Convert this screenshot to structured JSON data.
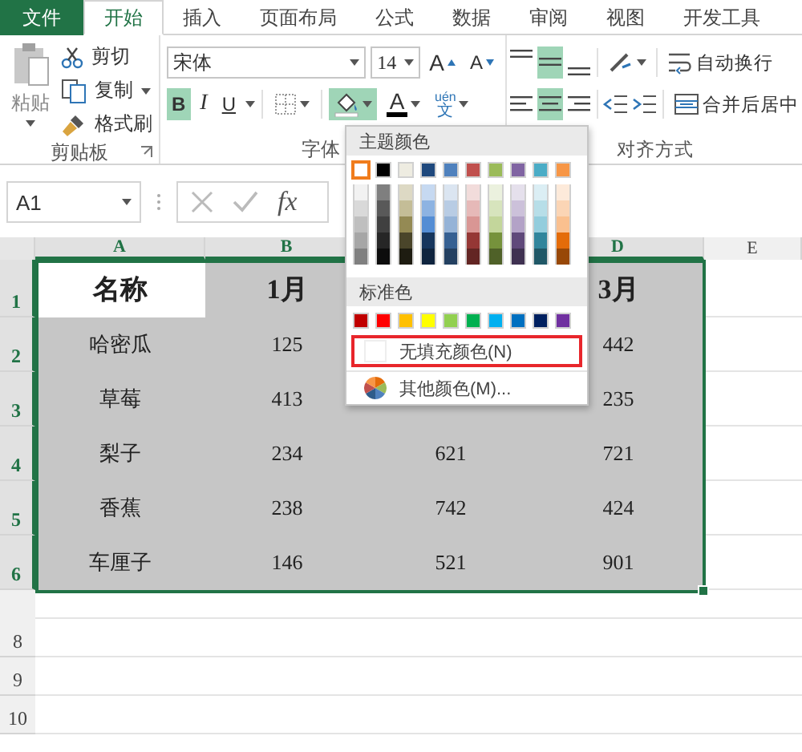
{
  "tabs": [
    {
      "label": "文件",
      "kind": "file",
      "selected": false
    },
    {
      "label": "开始",
      "kind": "tab",
      "selected": true
    },
    {
      "label": "插入",
      "kind": "tab",
      "selected": false
    },
    {
      "label": "页面布局",
      "kind": "tab",
      "selected": false
    },
    {
      "label": "公式",
      "kind": "tab",
      "selected": false
    },
    {
      "label": "数据",
      "kind": "tab",
      "selected": false
    },
    {
      "label": "审阅",
      "kind": "tab",
      "selected": false
    },
    {
      "label": "视图",
      "kind": "tab",
      "selected": false
    },
    {
      "label": "开发工具",
      "kind": "tab",
      "selected": false
    }
  ],
  "ribbon": {
    "clipboard": {
      "paste": "粘贴",
      "cut": "剪切",
      "copy": "复制",
      "format_painter": "格式刷",
      "label": "剪贴板"
    },
    "font": {
      "name": "宋体",
      "size": "14",
      "grow": "A",
      "shrink": "A",
      "bold": {
        "label": "B",
        "on": true
      },
      "italic": {
        "label": "I",
        "on": false
      },
      "underline": {
        "label": "U",
        "on": false
      },
      "fill_color": {
        "on": true
      },
      "font_color": {
        "label": "A"
      },
      "phonetic": {
        "top": "uén",
        "bottom": "文"
      },
      "label": "字体"
    },
    "alignment": {
      "vertical": [
        {
          "kind": "top",
          "selected": false
        },
        {
          "kind": "middle",
          "selected": true
        },
        {
          "kind": "bottom",
          "selected": false
        }
      ],
      "horizontal": [
        {
          "kind": "left",
          "selected": false
        },
        {
          "kind": "center",
          "selected": true
        },
        {
          "kind": "right",
          "selected": false
        }
      ],
      "wrap": "自动换行",
      "merge": "合并后居中",
      "label": "对齐方式"
    }
  },
  "formula_bar": {
    "name_box": "A1",
    "fx": "fx"
  },
  "sheet": {
    "columns": [
      {
        "label": "A",
        "selected": true
      },
      {
        "label": "B",
        "selected": true
      },
      {},
      {
        "label": "D",
        "selected": true
      },
      {
        "label": "E",
        "selected": false
      }
    ],
    "rows": [
      {
        "number": "1",
        "selected": true,
        "cells": [
          {
            "text": "名称",
            "active": true
          },
          {
            "text": "1月",
            "active": false
          },
          {},
          {
            "text": "3月",
            "active": false
          }
        ]
      },
      {
        "number": "2",
        "selected": true,
        "cells": [
          {
            "text": "哈密瓜",
            "active": false
          },
          {
            "text": "125",
            "active": false
          },
          {},
          {
            "text": "442",
            "active": false
          }
        ]
      },
      {
        "number": "3",
        "selected": true,
        "cells": [
          {
            "text": "草莓",
            "active": false
          },
          {
            "text": "413",
            "active": false
          },
          {},
          {
            "text": "235",
            "active": false
          }
        ]
      },
      {
        "number": "4",
        "selected": true,
        "cells": [
          {
            "text": "梨子",
            "active": false
          },
          {
            "text": "234",
            "active": false
          },
          {
            "text": "621",
            "active": false
          },
          {
            "text": "721",
            "active": false
          }
        ]
      },
      {
        "number": "5",
        "selected": true,
        "cells": [
          {
            "text": "香蕉",
            "active": false
          },
          {
            "text": "238",
            "active": false
          },
          {
            "text": "742",
            "active": false
          },
          {
            "text": "424",
            "active": false
          }
        ]
      },
      {
        "number": "6",
        "selected": true,
        "cells": [
          {
            "text": "车厘子",
            "active": false
          },
          {
            "text": "146",
            "active": false
          },
          {
            "text": "521",
            "active": false
          },
          {
            "text": "901",
            "active": false
          }
        ]
      }
    ],
    "extra_rows": [
      {
        "number": "8",
        "selected": false
      },
      {
        "number": "9",
        "selected": false
      },
      {
        "number": "10",
        "selected": false
      }
    ]
  },
  "color_menu": {
    "theme_title": "主题颜色",
    "theme": [
      {
        "color": "#ffffff",
        "selected": true,
        "shades": [
          {
            "color": "#f2f2f2"
          },
          {
            "color": "#d9d9d9"
          },
          {
            "color": "#bfbfbf"
          },
          {
            "color": "#a6a6a6"
          },
          {
            "color": "#808080"
          }
        ]
      },
      {
        "color": "#000000",
        "selected": false,
        "shades": [
          {
            "color": "#7f7f7f"
          },
          {
            "color": "#595959"
          },
          {
            "color": "#404040"
          },
          {
            "color": "#262626"
          },
          {
            "color": "#0d0d0d"
          }
        ]
      },
      {
        "color": "#eeece1",
        "selected": false,
        "shades": [
          {
            "color": "#ddd9c4"
          },
          {
            "color": "#c4bd97"
          },
          {
            "color": "#948a54"
          },
          {
            "color": "#4a452a"
          },
          {
            "color": "#1e1c11"
          }
        ]
      },
      {
        "color": "#1f497d",
        "selected": false,
        "shades": [
          {
            "color": "#c6d9f1"
          },
          {
            "color": "#8db3e2"
          },
          {
            "color": "#548dd4"
          },
          {
            "color": "#17365d"
          },
          {
            "color": "#0f243e"
          }
        ]
      },
      {
        "color": "#4f81bd",
        "selected": false,
        "shades": [
          {
            "color": "#dbe5f1"
          },
          {
            "color": "#b8cce4"
          },
          {
            "color": "#95b3d7"
          },
          {
            "color": "#366092"
          },
          {
            "color": "#244061"
          }
        ]
      },
      {
        "color": "#c0504d",
        "selected": false,
        "shades": [
          {
            "color": "#f2dcdb"
          },
          {
            "color": "#e6b9b8"
          },
          {
            "color": "#d99694"
          },
          {
            "color": "#953735"
          },
          {
            "color": "#632523"
          }
        ]
      },
      {
        "color": "#9bbb59",
        "selected": false,
        "shades": [
          {
            "color": "#ebf1de"
          },
          {
            "color": "#d7e4bd"
          },
          {
            "color": "#c3d69b"
          },
          {
            "color": "#76923c"
          },
          {
            "color": "#4f6128"
          }
        ]
      },
      {
        "color": "#8064a2",
        "selected": false,
        "shades": [
          {
            "color": "#e5e0ec"
          },
          {
            "color": "#ccc1da"
          },
          {
            "color": "#b3a2c7"
          },
          {
            "color": "#5f497a"
          },
          {
            "color": "#3f3151"
          }
        ]
      },
      {
        "color": "#4bacc6",
        "selected": false,
        "shades": [
          {
            "color": "#dbeef4"
          },
          {
            "color": "#b7dee8"
          },
          {
            "color": "#93cddd"
          },
          {
            "color": "#31859c"
          },
          {
            "color": "#205867"
          }
        ]
      },
      {
        "color": "#f79646",
        "selected": false,
        "shades": [
          {
            "color": "#fdeada"
          },
          {
            "color": "#fbd5b5"
          },
          {
            "color": "#fac08f"
          },
          {
            "color": "#e46c0a"
          },
          {
            "color": "#984807"
          }
        ]
      }
    ],
    "standard_title": "标准色",
    "standard": [
      {
        "color": "#c00000",
        "selected": false
      },
      {
        "color": "#ff0000",
        "selected": false
      },
      {
        "color": "#ffc000",
        "selected": false
      },
      {
        "color": "#ffff00",
        "selected": false
      },
      {
        "color": "#92d050",
        "selected": false
      },
      {
        "color": "#00b050",
        "selected": false
      },
      {
        "color": "#00b0f0",
        "selected": false
      },
      {
        "color": "#0070c0",
        "selected": false
      },
      {
        "color": "#002060",
        "selected": false
      },
      {
        "color": "#7030a0",
        "selected": false
      }
    ],
    "no_fill": {
      "label": "无填充颜色(N)",
      "highlighted": true
    },
    "more": {
      "label": "其他颜色(M)..."
    }
  }
}
